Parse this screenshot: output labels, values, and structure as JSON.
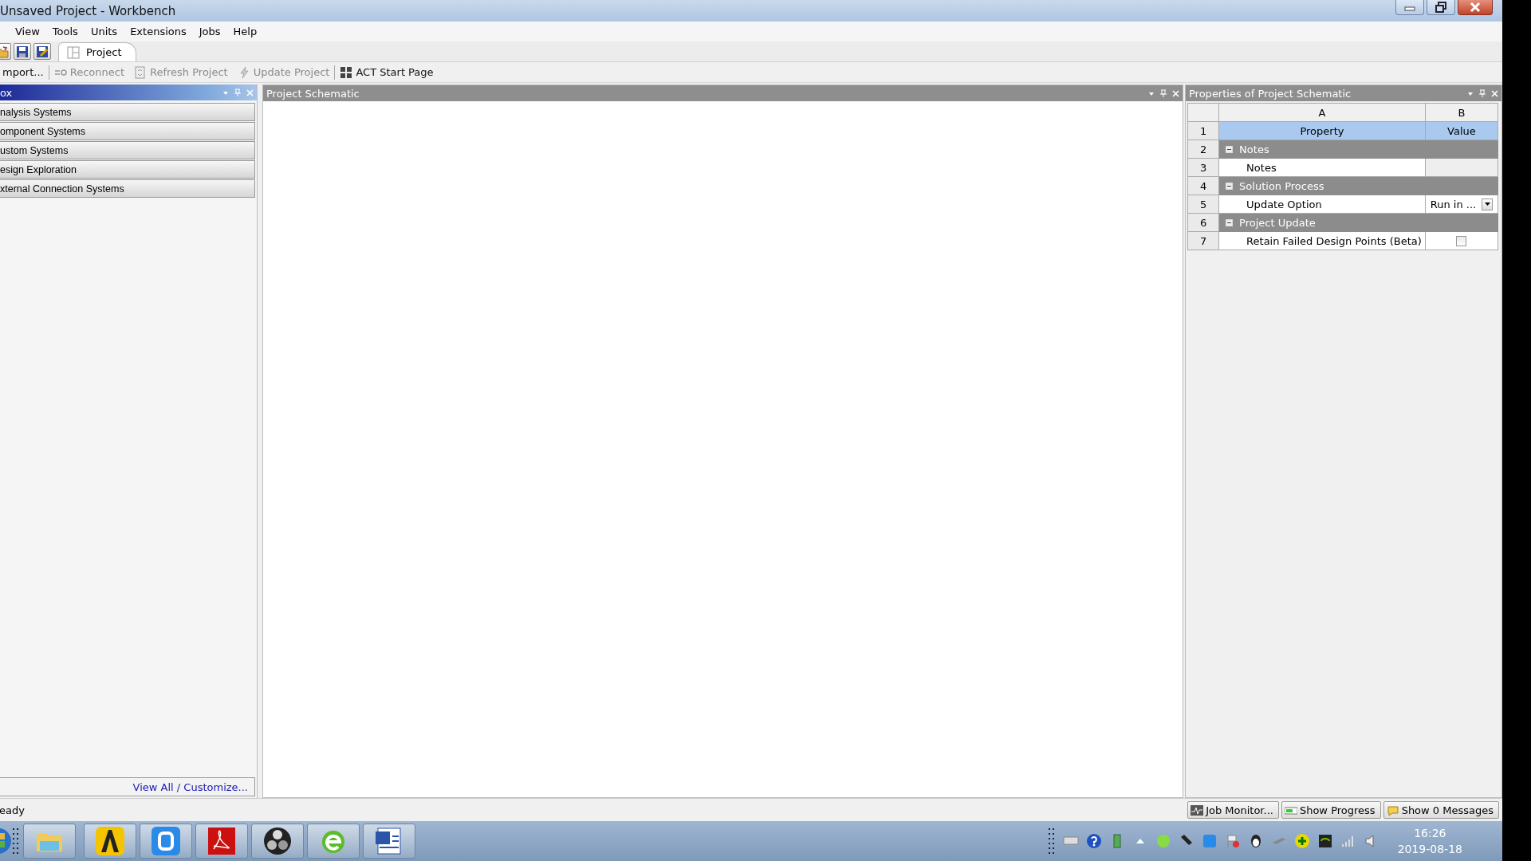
{
  "window": {
    "title": "Unsaved Project - Workbench"
  },
  "menu": [
    "View",
    "Tools",
    "Units",
    "Extensions",
    "Jobs",
    "Help"
  ],
  "tabs": [
    {
      "label": "Project",
      "selected": true
    }
  ],
  "toolbar": [
    {
      "label": "mport...",
      "disabled": false
    },
    {
      "label": "Reconnect",
      "disabled": true
    },
    {
      "label": "Refresh Project",
      "disabled": true
    },
    {
      "label": "Update Project",
      "disabled": true
    },
    {
      "label": "ACT Start Page",
      "disabled": false
    }
  ],
  "toolbox": {
    "title": "ox",
    "groups": [
      "nalysis Systems",
      "omponent Systems",
      "ustom Systems",
      "esign Exploration",
      "xternal Connection Systems"
    ],
    "link": "View All / Customize..."
  },
  "schematic": {
    "title": "Project Schematic"
  },
  "properties": {
    "title": "Properties of Project Schematic",
    "columns": [
      "A",
      "B"
    ],
    "rows": [
      {
        "number": "1",
        "kind": "header",
        "property": "Property",
        "value": "Value"
      },
      {
        "number": "2",
        "kind": "group",
        "property": "Notes",
        "expanded": true
      },
      {
        "number": "3",
        "kind": "text",
        "property": "Notes"
      },
      {
        "number": "4",
        "kind": "group",
        "property": "Solution Process",
        "expanded": true
      },
      {
        "number": "5",
        "kind": "dropdown",
        "property": "Update Option",
        "value": "Run in ..."
      },
      {
        "number": "6",
        "kind": "group",
        "property": "Project Update",
        "expanded": true
      },
      {
        "number": "7",
        "kind": "checkbox",
        "property": "Retain Failed Design Points (Beta)",
        "checked": false
      }
    ]
  },
  "status_bar": {
    "text": "eady",
    "buttons": [
      "Job Monitor...",
      "Show Progress",
      "Show 0 Messages"
    ]
  },
  "clock": {
    "time": "16:26",
    "date": "2019-08-18"
  }
}
